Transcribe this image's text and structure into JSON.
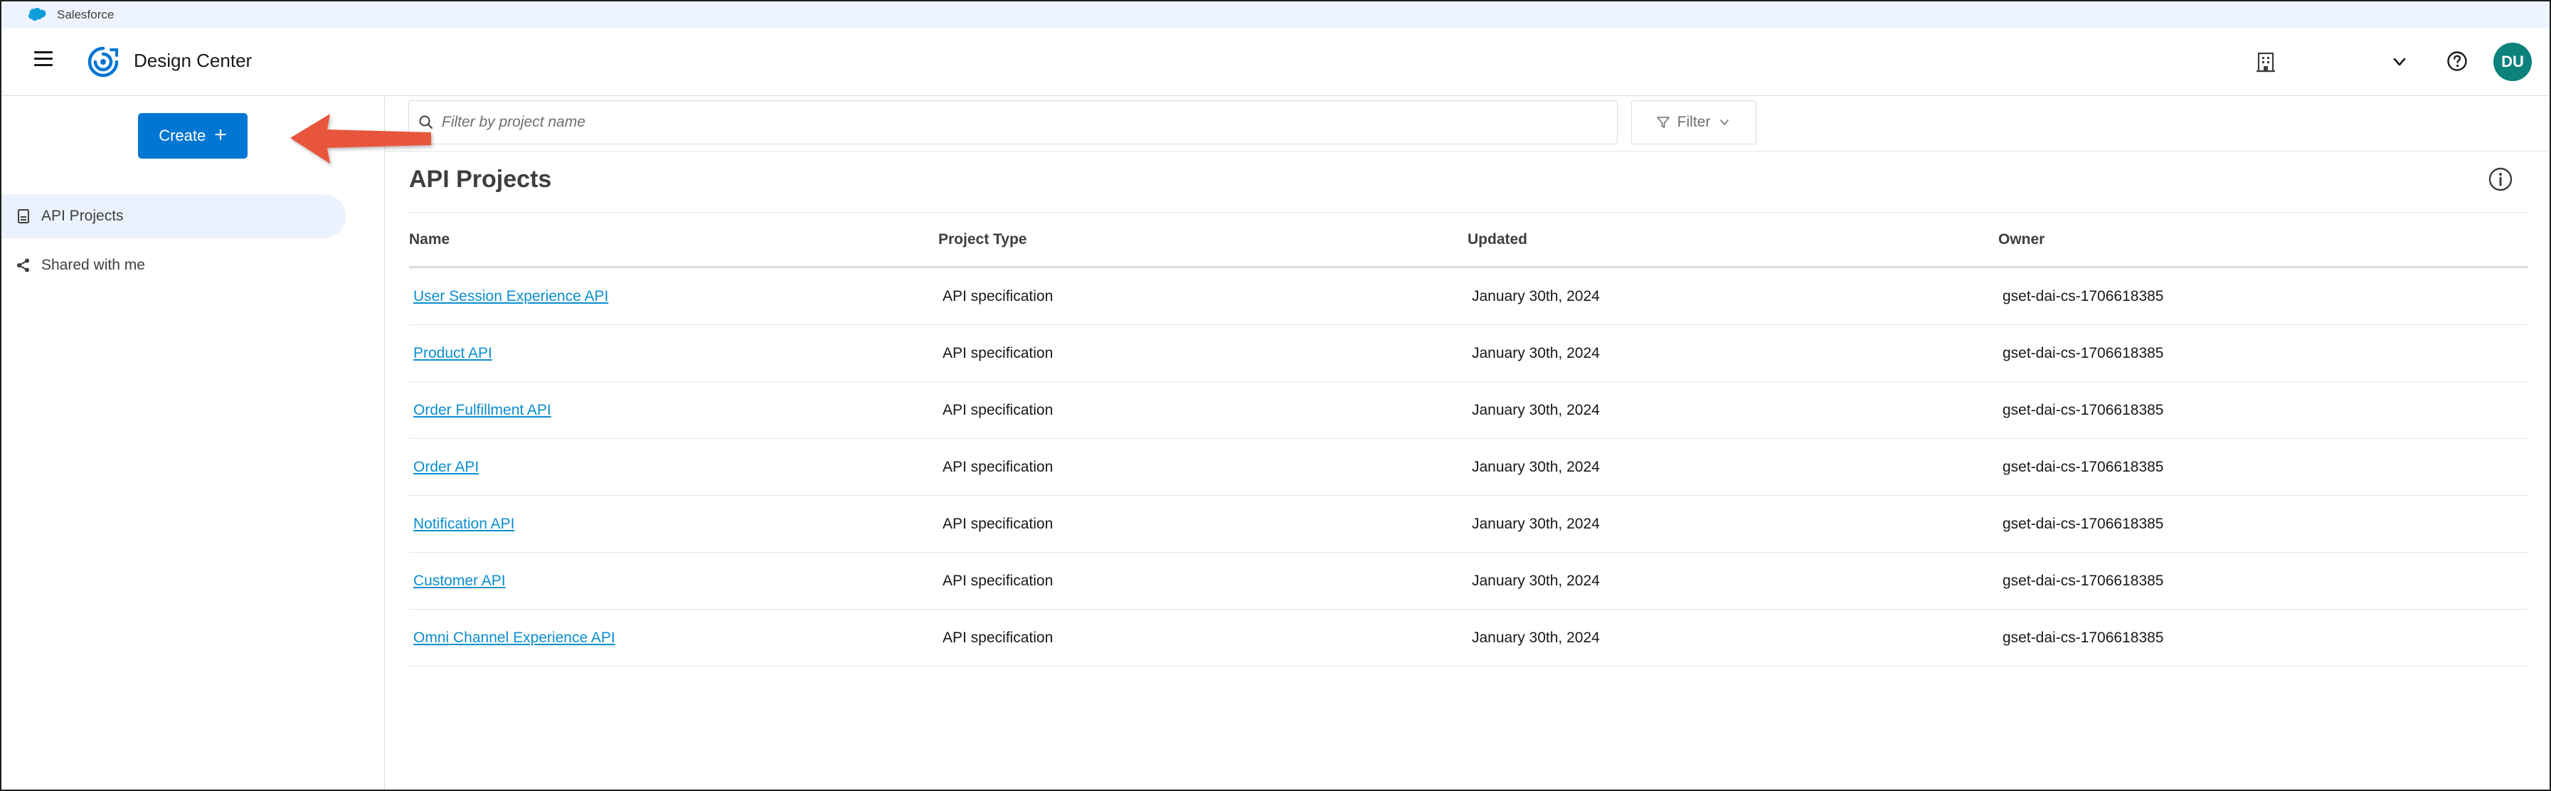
{
  "topbar": {
    "brand_label": "Salesforce",
    "icon": "salesforce-cloud-icon"
  },
  "header": {
    "app_title": "Design Center",
    "icons": [
      "hamburger-menu-icon",
      "design-center-logo-icon",
      "organization-icon",
      "chevron-down-icon",
      "help-icon"
    ],
    "avatar_initials": "DU",
    "avatar_color": "#0b827c"
  },
  "sidebar": {
    "create_label": "Create",
    "create_color": "#0176d3",
    "items": [
      {
        "label": "API Projects",
        "icon": "document-icon",
        "active": true
      },
      {
        "label": "Shared with me",
        "icon": "share-icon",
        "active": false
      }
    ]
  },
  "annotation": {
    "arrow_color": "#e8553e"
  },
  "main": {
    "search_placeholder": "Filter by project name",
    "filter_label": "Filter",
    "page_title": "API Projects",
    "columns": [
      "Name",
      "Project Type",
      "Updated",
      "Owner"
    ],
    "rows": [
      {
        "name": "User Session Experience API",
        "type": "API specification",
        "updated": "January 30th, 2024",
        "owner": "gset-dai-cs-1706618385"
      },
      {
        "name": "Product API",
        "type": "API specification",
        "updated": "January 30th, 2024",
        "owner": "gset-dai-cs-1706618385"
      },
      {
        "name": "Order Fulfillment API",
        "type": "API specification",
        "updated": "January 30th, 2024",
        "owner": "gset-dai-cs-1706618385"
      },
      {
        "name": "Order API",
        "type": "API specification",
        "updated": "January 30th, 2024",
        "owner": "gset-dai-cs-1706618385"
      },
      {
        "name": "Notification API",
        "type": "API specification",
        "updated": "January 30th, 2024",
        "owner": "gset-dai-cs-1706618385"
      },
      {
        "name": "Customer API",
        "type": "API specification",
        "updated": "January 30th, 2024",
        "owner": "gset-dai-cs-1706618385"
      },
      {
        "name": "Omni Channel Experience API",
        "type": "API specification",
        "updated": "January 30th, 2024",
        "owner": "gset-dai-cs-1706618385"
      }
    ],
    "link_color": "#0b8ecf"
  }
}
